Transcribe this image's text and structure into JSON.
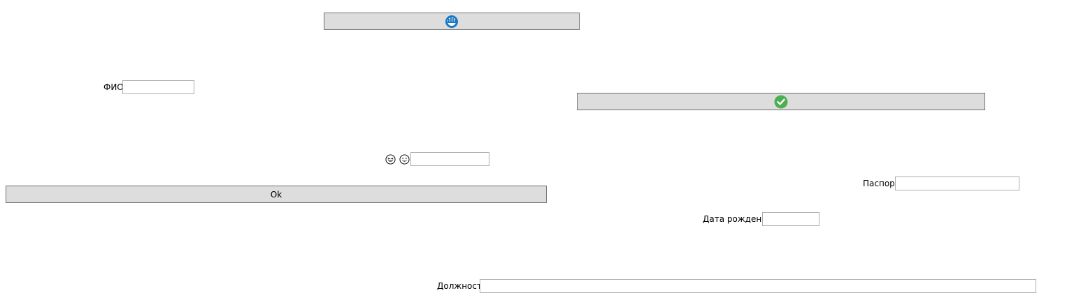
{
  "top_button": {
    "icon": "blue-refresh-icon"
  },
  "fio": {
    "label": "ФИО",
    "value": "",
    "placeholder": ""
  },
  "check_button": {
    "icon": "green-check-icon"
  },
  "emoji_field": {
    "icons": [
      "laughing-face-icon",
      "grinning-face-icon"
    ],
    "value": ""
  },
  "ok_button": {
    "label": "Ok"
  },
  "passport": {
    "label": "Паспорт",
    "value": ""
  },
  "birth_date": {
    "label": "Дата рождения",
    "value": ""
  },
  "position": {
    "label": "Должность",
    "value": ""
  },
  "colors": {
    "button_bg": "#dddddd",
    "button_border": "#707070",
    "field_border": "#adadad",
    "blue_icon": "#1a78c2",
    "green_icon": "#4caf50"
  }
}
